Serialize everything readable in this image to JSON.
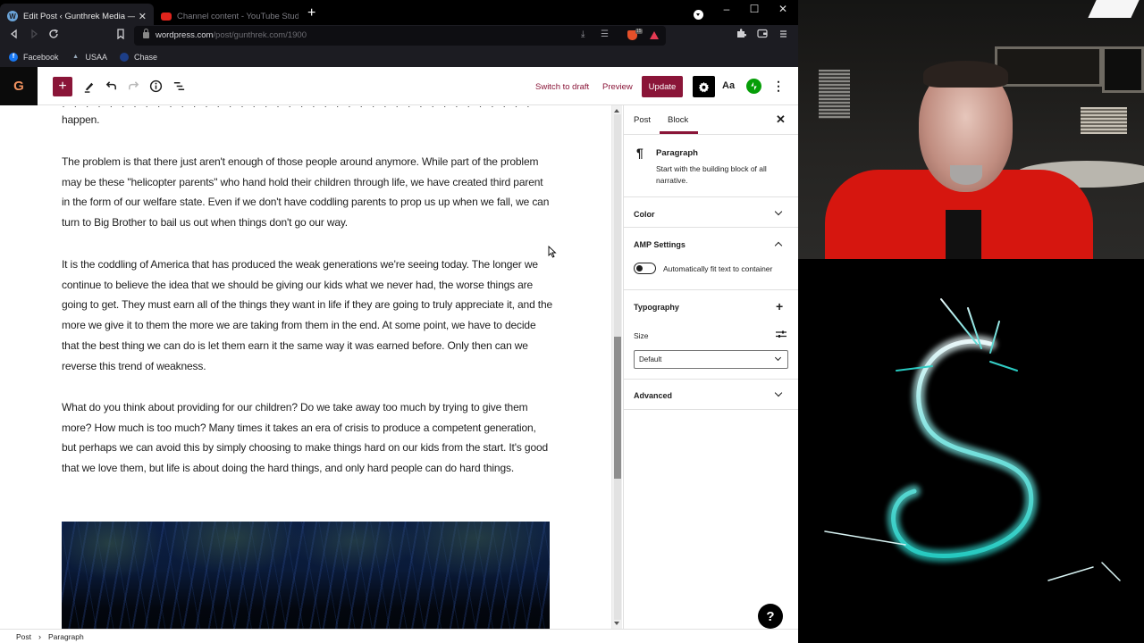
{
  "browser": {
    "tabs": [
      {
        "title": "Edit Post ‹ Gunthrek Media — W",
        "icon": "wordpress-icon",
        "active": true
      },
      {
        "title": "Channel content - YouTube Studio",
        "icon": "youtube-icon",
        "active": false
      }
    ],
    "new_tab_label": "+",
    "window_controls": {
      "minimize": "–",
      "maximize": "☐",
      "close": "✕"
    },
    "url": {
      "domain": "wordpress.com",
      "path": "/post/gunthrek.com/1900"
    },
    "brave_badge": "15",
    "bookmarks": [
      {
        "label": "Facebook",
        "icon": "facebook-icon"
      },
      {
        "label": "USAA",
        "icon": "usaa-icon"
      },
      {
        "label": "Chase",
        "icon": "chase-icon"
      }
    ]
  },
  "editor": {
    "site_logo": "G",
    "toolbar": {
      "inserter_label": "+",
      "switch_to_draft": "Switch to draft",
      "preview": "Preview",
      "update": "Update",
      "styles_label": "Aa",
      "more_label": "⋮"
    },
    "content": {
      "partial_top_line": "happen.",
      "paragraphs": [
        "The problem is that there just aren't enough of those people around anymore.  While part of the problem may be these \"helicopter parents\" who hand hold their children through life, we have created third parent in the form of our welfare state.  Even if we don't have coddling parents to prop us up when we fall, we can turn to Big Brother to bail us out when things don't go our way.",
        "It is the coddling of America that has produced the weak generations we're seeing today.  The longer we continue to believe the idea that we should be giving our kids what we never had, the worse things are going to get.  They must earn all of the things they want in life if they are going to truly appreciate it, and the more we give it to them the more we are taking from them in the end.  At some point, we have to decide that the best thing we can do is let them earn it the same way it was earned before.  Only then can we reverse this trend of weakness.",
        "What do you think about providing for our children?  Do we take away too much by trying to give them more?  How much is too much?  Many times it takes an era of crisis to produce a competent generation, but perhaps we can avoid this by simply choosing to make things hard on our kids from the start.  It's good that we love them, but life is about doing the hard things, and only hard people can do hard things."
      ]
    },
    "scroll": {
      "thumb_start_fraction": 0.44,
      "thumb_size_fraction": 0.28
    },
    "sidebar": {
      "tabs": [
        {
          "label": "Post",
          "active": false
        },
        {
          "label": "Block",
          "active": true
        }
      ],
      "close_label": "✕",
      "block_card": {
        "icon": "¶",
        "title": "Paragraph",
        "description": "Start with the building block of all narrative."
      },
      "panels": {
        "color": {
          "title": "Color",
          "expanded": false
        },
        "amp": {
          "title": "AMP Settings",
          "expanded": true,
          "toggle_label": "Automatically fit text to container",
          "toggle_on": false
        },
        "typography": {
          "title": "Typography",
          "size_label": "Size",
          "size_value": "Default"
        },
        "advanced": {
          "title": "Advanced",
          "expanded": false
        }
      }
    },
    "help_label": "?",
    "breadcrumb": [
      "Post",
      "Paragraph"
    ],
    "breadcrumb_separator": "›"
  },
  "colors": {
    "accent": "#8a1538",
    "jetpack": "#069e08",
    "browser_bg": "#1c1c22"
  }
}
